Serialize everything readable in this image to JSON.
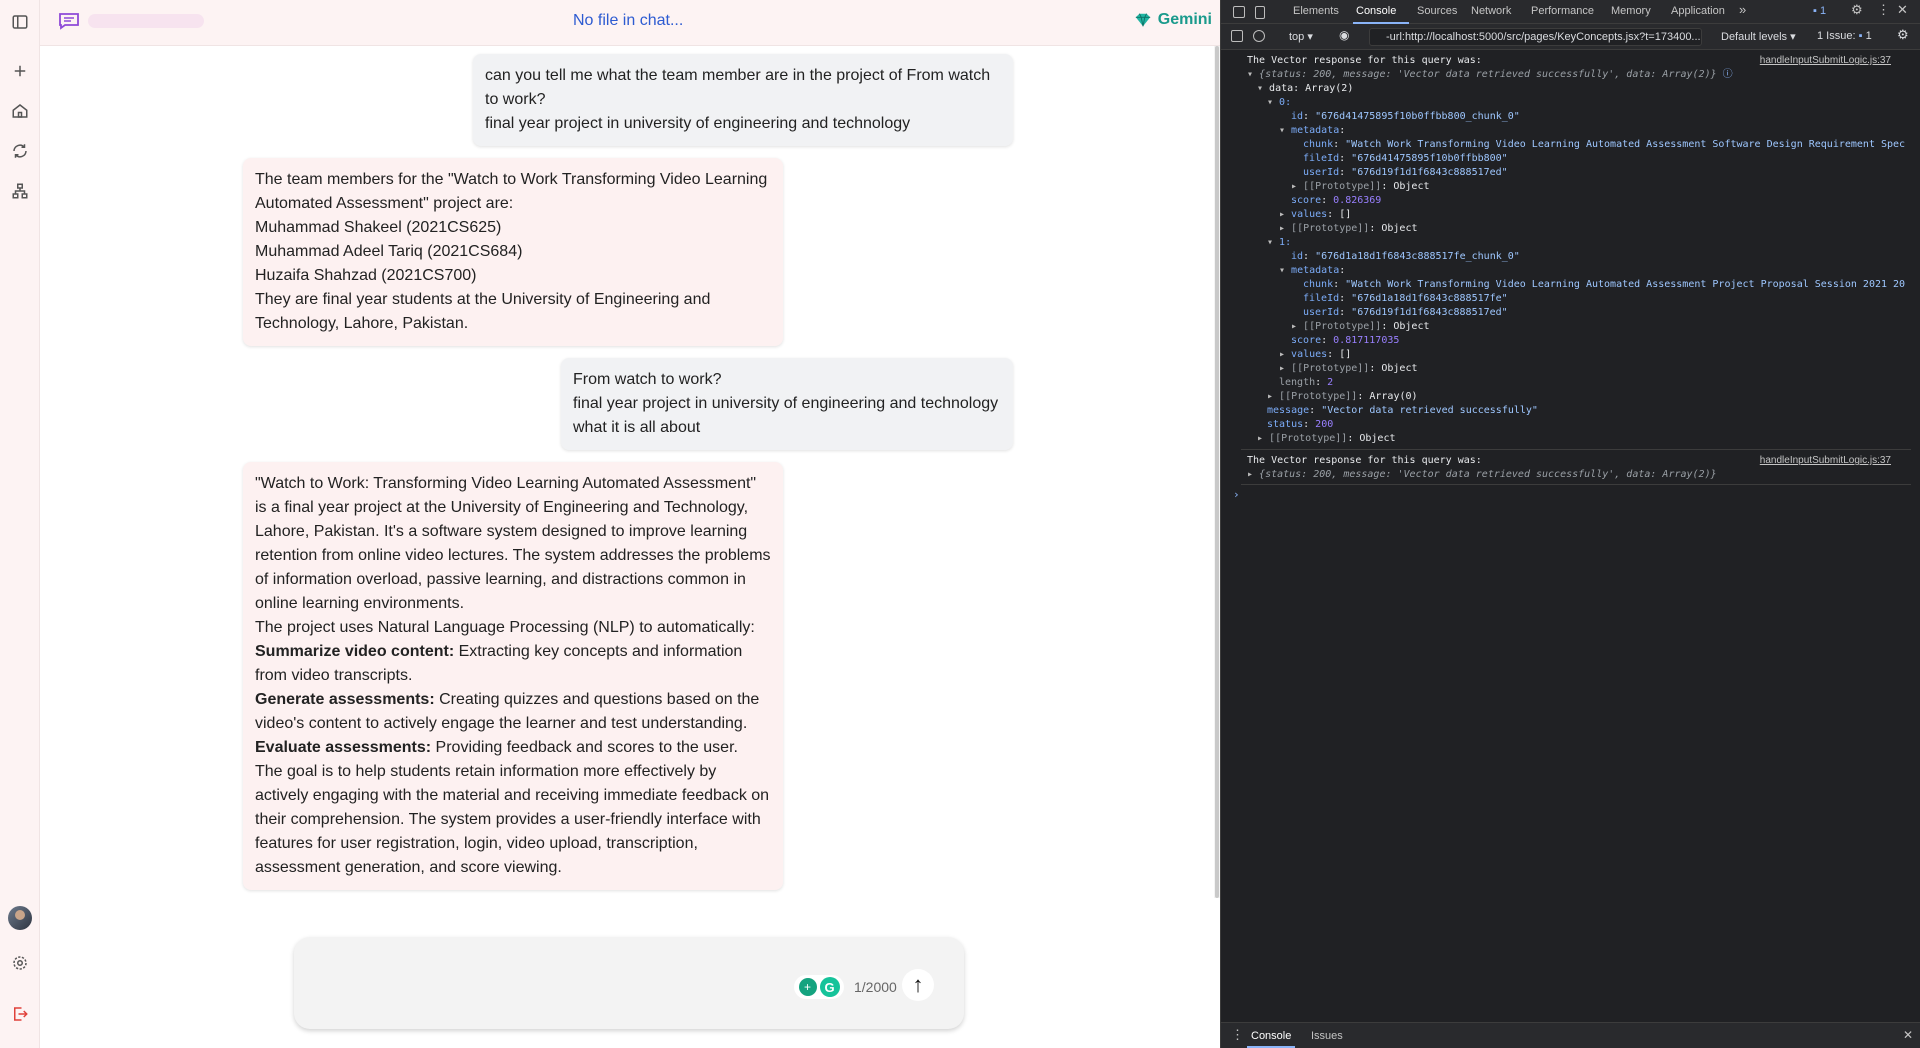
{
  "header": {
    "file_status": "No file in chat...",
    "model_name": "Gemini"
  },
  "conversation": [
    {
      "role": "user",
      "lines": [
        "can you tell me what the team member are in the project of From watch to work?",
        "final year project in university of engineering and technology"
      ]
    },
    {
      "role": "assistant",
      "lines": [
        "The team members for the \"Watch to Work Transforming Video Learning Automated Assessment\" project are:",
        "Muhammad Shakeel (2021CS625)",
        "Muhammad Adeel Tariq (2021CS684)",
        "Huzaifa Shahzad (2021CS700)",
        "They are final year students at the University of Engineering and Technology, Lahore, Pakistan."
      ]
    },
    {
      "role": "user",
      "lines": [
        "From watch to work?",
        "final year project in university of engineering and technology",
        "what it is all about"
      ]
    },
    {
      "role": "assistant",
      "paragraphs": [
        {
          "text": "\"Watch to Work: Transforming Video Learning Automated Assessment\" is a final year project at the University of Engineering and Technology, Lahore, Pakistan. It's a software system designed to improve learning retention from online video lectures. The system addresses the problems of information overload, passive learning, and distractions common in online learning environments."
        },
        {
          "text": "The project uses Natural Language Processing (NLP) to automatically:"
        },
        {
          "bold": "Summarize video content:",
          "text": " Extracting key concepts and information from video transcripts."
        },
        {
          "bold": "Generate assessments:",
          "text": " Creating quizzes and questions based on the video's content to actively engage the learner and test understanding."
        },
        {
          "bold": "Evaluate assessments:",
          "text": " Providing feedback and scores to the user."
        },
        {
          "text": "The goal is to help students retain information more effectively by actively engaging with the material and receiving immediate feedback on their comprehension. The system provides a user-friendly interface with features for user registration, login, video upload, transcription, assessment generation, and score viewing."
        }
      ]
    }
  ],
  "composer": {
    "char_count": "1/2000",
    "ext_a": "+",
    "ext_g": "G",
    "send_glyph": "↑"
  },
  "devtools": {
    "tabs": [
      "Elements",
      "Console",
      "Sources",
      "Network",
      "Performance",
      "Memory",
      "Application"
    ],
    "active_tab": "Console",
    "more_tabs": "»",
    "message_badge": "1",
    "context": "top ▾",
    "filter_value": "-url:http://localhost:5000/src/pages/KeyConcepts.jsx?t=173400...",
    "levels": "Default levels ▾",
    "issues": "1 Issue:",
    "issues_count": "1",
    "source_link": "handleInputSubmitLogic.js:37",
    "log_heading": "The Vector response for this query was:",
    "obj_preview": "{status: 200, message: 'Vector data retrieved successfully', data: Array(2)}",
    "data_label": "data: Array(2)",
    "item0": {
      "index": "0:",
      "id": "\"676d41475895f10b0ffbb800_chunk_0\"",
      "chunk": "\"Watch Work Transforming Video Learning Automated Assessment Software Design Requirement Spec",
      "fileId": "\"676d41475895f10b0ffbb800\"",
      "userId": "\"676d19f1d1f6843c888517ed\"",
      "score": "0.826369"
    },
    "item1": {
      "index": "1:",
      "id": "\"676d1a18d1f6843c888517fe_chunk_0\"",
      "chunk": "\"Watch Work Transforming Video Learning Automated Assessment Project Proposal Session 2021 20",
      "fileId": "\"676d1a18d1f6843c888517fe\"",
      "userId": "\"676d19f1d1f6843c888517ed\"",
      "score": "0.817117035"
    },
    "length": "2",
    "message": "\"Vector data retrieved successfully\"",
    "status": "200",
    "drawer_tabs": [
      "Console",
      "Issues"
    ]
  }
}
